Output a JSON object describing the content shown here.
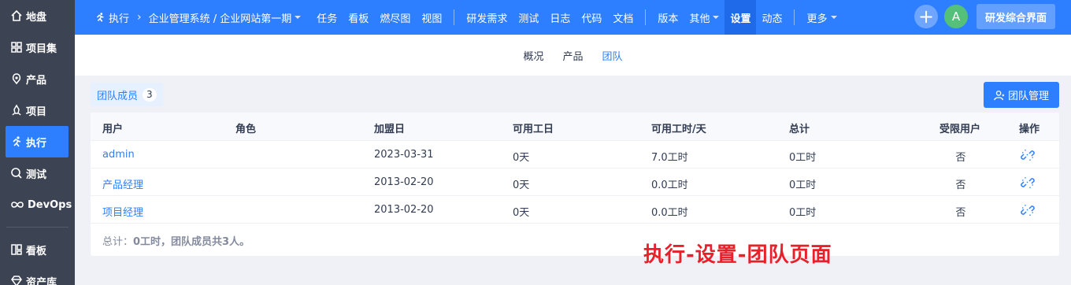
{
  "sidebar": {
    "items": [
      {
        "label": "地盘",
        "icon": "home-icon"
      },
      {
        "label": "项目集",
        "icon": "grid-icon"
      },
      {
        "label": "产品",
        "icon": "product-icon"
      },
      {
        "label": "项目",
        "icon": "project-icon"
      },
      {
        "label": "执行",
        "icon": "run-icon",
        "active": true
      },
      {
        "label": "测试",
        "icon": "test-icon"
      },
      {
        "label": "DevOps",
        "icon": "infinity-icon"
      },
      {
        "label": "看板",
        "icon": "kanban-icon"
      },
      {
        "label": "资产库",
        "icon": "diamond-icon"
      }
    ]
  },
  "topbar": {
    "execution_label": "执行",
    "breadcrumb_project": "企业管理系统 / 企业网站第一期",
    "nav": [
      "任务",
      "看板",
      "燃尽图",
      "视图"
    ],
    "nav2": [
      "研发需求",
      "测试",
      "日志",
      "代码",
      "文档"
    ],
    "nav3": [
      "版本",
      "其他"
    ],
    "settings": "设置",
    "activity": "动态",
    "more": "更多",
    "plus": "+",
    "avatar": "A",
    "ide_button": "研发综合界面"
  },
  "subnav": {
    "items": [
      "概况",
      "产品",
      "团队"
    ],
    "active": "团队"
  },
  "team": {
    "tab_label": "团队成员",
    "count": "3",
    "manage_button": "团队管理",
    "columns": [
      "用户",
      "角色",
      "加盟日",
      "可用工日",
      "可用工时/天",
      "总计",
      "受限用户",
      "操作"
    ],
    "rows": [
      {
        "user": "admin",
        "role": "",
        "join_date": "2023-03-31",
        "days": "0天",
        "hours_per_day": "7.0工时",
        "total": "0工时",
        "limited": "否"
      },
      {
        "user": "产品经理",
        "role": "",
        "join_date": "2013-02-20",
        "days": "0天",
        "hours_per_day": "0.0工时",
        "total": "0工时",
        "limited": "否"
      },
      {
        "user": "项目经理",
        "role": "",
        "join_date": "2013-02-20",
        "days": "0天",
        "hours_per_day": "0.0工时",
        "total": "0工时",
        "limited": "否"
      }
    ],
    "summary_prefix": "总计：",
    "summary_bold": "0工时，团队成员共3人。"
  },
  "caption": "执行-设置-团队页面",
  "colors": {
    "primary": "#2e7fff",
    "sidebar": "#3c4353",
    "caption": "#e8202a"
  }
}
